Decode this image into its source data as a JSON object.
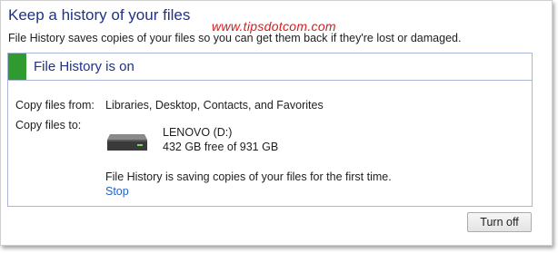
{
  "header": {
    "title": "Keep a history of your files",
    "watermark": "www.tipsdotcom.com",
    "description": "File History saves copies of your files so you can get them back if they're lost or damaged."
  },
  "status": {
    "title": "File History is on",
    "indicator_color": "#2f9a2f"
  },
  "details": {
    "copy_from_label": "Copy files from:",
    "copy_from_value": "Libraries, Desktop, Contacts, and Favorites",
    "copy_to_label": "Copy files to:",
    "drive_icon": "hard-drive-icon",
    "drive_name": "LENOVO (D:)",
    "drive_space": "432 GB free of 931 GB",
    "progress_message": "File History is saving copies of your files for the first time.",
    "stop_link": "Stop"
  },
  "actions": {
    "turn_off_label": "Turn off"
  }
}
